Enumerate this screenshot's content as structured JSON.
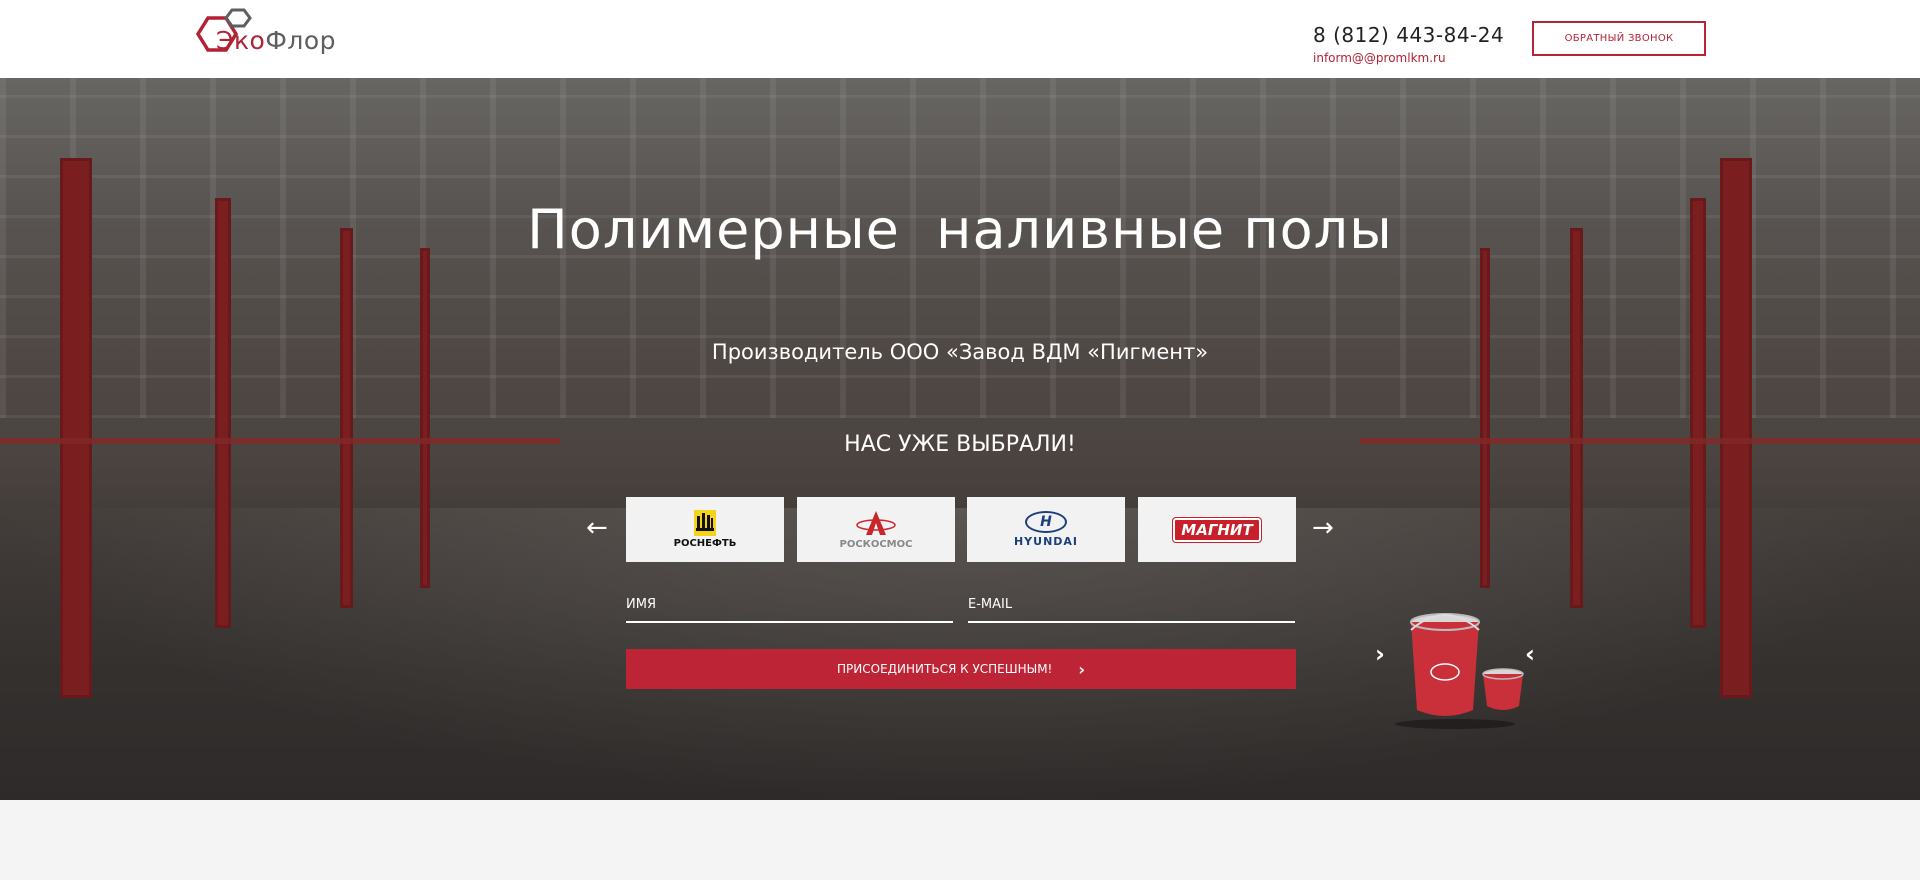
{
  "header": {
    "logo": {
      "part1": "Эко",
      "part2": "Флор"
    },
    "phone": "8 (812) 443-84-24",
    "email": "inform@@promlkm.ru",
    "callback_label": "ОБРАТНЫЙ ЗВОНОК"
  },
  "hero": {
    "title": "Полимерные  наливные полы",
    "subtitle": "Производитель ООО «Завод ВДМ «Пигмент»",
    "chosen_title": "НАС УЖЕ ВЫБРАЛИ!",
    "clients": [
      {
        "name": "РОСНЕФТЬ",
        "icon": "rosneft-logo"
      },
      {
        "name": "РОСКОСМОС",
        "icon": "roscosmos-logo"
      },
      {
        "name": "HYUNDAI",
        "icon": "hyundai-logo"
      },
      {
        "name": "МАГНИТ",
        "icon": "magnit-logo"
      }
    ],
    "form": {
      "name_placeholder": "ИМЯ",
      "email_placeholder": "E-MAIL",
      "submit_label": "ПРИСОЕДИНИТЬСЯ К УСПЕШНЫМ!"
    },
    "product": {
      "brand": "ЭкоФлор"
    }
  },
  "colors": {
    "accent": "#bd2436",
    "header_bg": "#ffffff",
    "footer_bg": "#f4f4f4"
  }
}
